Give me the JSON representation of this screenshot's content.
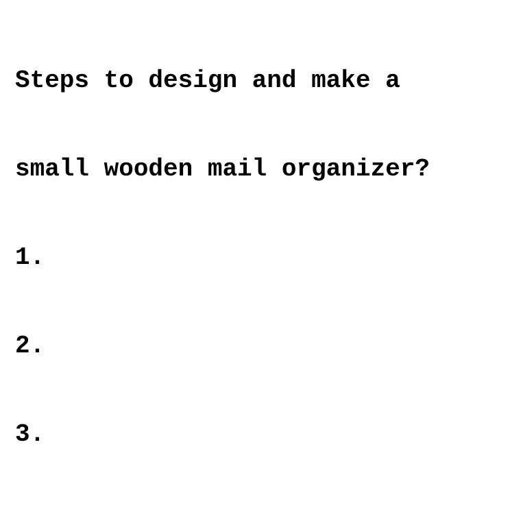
{
  "document": {
    "question_lines": [
      "Steps to design and make a",
      "small wooden mail organizer?"
    ],
    "list_items": [
      "1.",
      "2.",
      "3."
    ]
  }
}
